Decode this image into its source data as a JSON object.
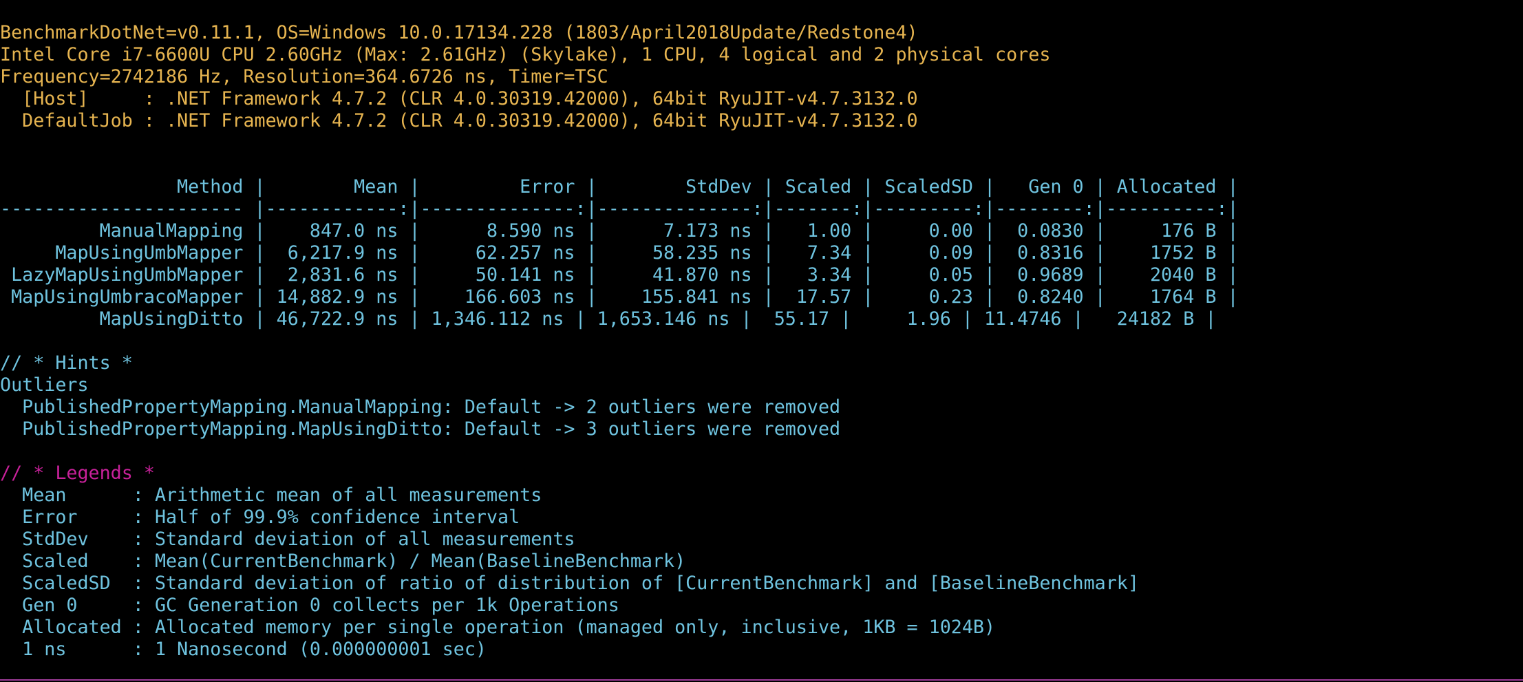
{
  "environment": {
    "lines": [
      "BenchmarkDotNet=v0.11.1, OS=Windows 10.0.17134.228 (1803/April2018Update/Redstone4)",
      "Intel Core i7-6600U CPU 2.60GHz (Max: 2.61GHz) (Skylake), 1 CPU, 4 logical and 2 physical cores",
      "Frequency=2742186 Hz, Resolution=364.6726 ns, Timer=TSC",
      "  [Host]     : .NET Framework 4.7.2 (CLR 4.0.30319.42000), 64bit RyuJIT-v4.7.3132.0",
      "  DefaultJob : .NET Framework 4.7.2 (CLR 4.0.30319.42000), 64bit RyuJIT-v4.7.3132.0"
    ]
  },
  "results_table": {
    "header": "                Method |        Mean |         Error |        StdDev | Scaled | ScaledSD |   Gen 0 | Allocated |",
    "separator": "---------------------- |------------:|--------------:|--------------:|-------:|---------:|--------:|----------:|",
    "columns": [
      "Method",
      "Mean",
      "Error",
      "StdDev",
      "Scaled",
      "ScaledSD",
      "Gen 0",
      "Allocated"
    ],
    "rows": [
      {
        "method": "ManualMapping",
        "mean": "847.0 ns",
        "error": "8.590 ns",
        "stddev": "7.173 ns",
        "scaled": "1.00",
        "scaledsd": "0.00",
        "gen0": "0.0830",
        "allocated": "176 B",
        "text": "         ManualMapping |    847.0 ns |      8.590 ns |      7.173 ns |   1.00 |     0.00 |  0.0830 |     176 B |"
      },
      {
        "method": "MapUsingUmbMapper",
        "mean": "6,217.9 ns",
        "error": "62.257 ns",
        "stddev": "58.235 ns",
        "scaled": "7.34",
        "scaledsd": "0.09",
        "gen0": "0.8316",
        "allocated": "1752 B",
        "text": "     MapUsingUmbMapper |  6,217.9 ns |     62.257 ns |     58.235 ns |   7.34 |     0.09 |  0.8316 |    1752 B |"
      },
      {
        "method": "LazyMapUsingUmbMapper",
        "mean": "2,831.6 ns",
        "error": "50.141 ns",
        "stddev": "41.870 ns",
        "scaled": "3.34",
        "scaledsd": "0.05",
        "gen0": "0.9689",
        "allocated": "2040 B",
        "text": " LazyMapUsingUmbMapper |  2,831.6 ns |     50.141 ns |     41.870 ns |   3.34 |     0.05 |  0.9689 |    2040 B |"
      },
      {
        "method": "MapUsingUmbracoMapper",
        "mean": "14,882.9 ns",
        "error": "166.603 ns",
        "stddev": "155.841 ns",
        "scaled": "17.57",
        "scaledsd": "0.23",
        "gen0": "0.8240",
        "allocated": "1764 B",
        "text": " MapUsingUmbracoMapper | 14,882.9 ns |    166.603 ns |    155.841 ns |  17.57 |     0.23 |  0.8240 |    1764 B |"
      },
      {
        "method": "MapUsingDitto",
        "mean": "46,722.9 ns",
        "error": "1,346.112 ns",
        "stddev": "1,653.146 ns",
        "scaled": "55.17",
        "scaledsd": "1.96",
        "gen0": "11.4746",
        "allocated": "24182 B",
        "text": "         MapUsingDitto | 46,722.9 ns | 1,346.112 ns | 1,653.146 ns |  55.17 |     1.96 | 11.4746 |   24182 B |"
      }
    ]
  },
  "hints": {
    "title": "// * Hints *",
    "section": "Outliers",
    "items": [
      "  PublishedPropertyMapping.ManualMapping: Default -> 2 outliers were removed",
      "  PublishedPropertyMapping.MapUsingDitto: Default -> 3 outliers were removed"
    ]
  },
  "legends": {
    "title": "// * Legends *",
    "items": [
      "  Mean      : Arithmetic mean of all measurements",
      "  Error     : Half of 99.9% confidence interval",
      "  StdDev    : Standard deviation of all measurements",
      "  Scaled    : Mean(CurrentBenchmark) / Mean(BaselineBenchmark)",
      "  ScaledSD  : Standard deviation of ratio of distribution of [CurrentBenchmark] and [BaselineBenchmark]",
      "  Gen 0     : GC Generation 0 collects per 1k Operations",
      "  Allocated : Allocated memory per single operation (managed only, inclusive, 1KB = 1024B)",
      "  1 ns      : 1 Nanosecond (0.000000001 sec)"
    ]
  },
  "colors": {
    "background": "#000000",
    "environment_text": "#e6b450",
    "table_text": "#6fc3df",
    "legend_title": "#c8219a",
    "bottom_border": "#a03c9a"
  }
}
